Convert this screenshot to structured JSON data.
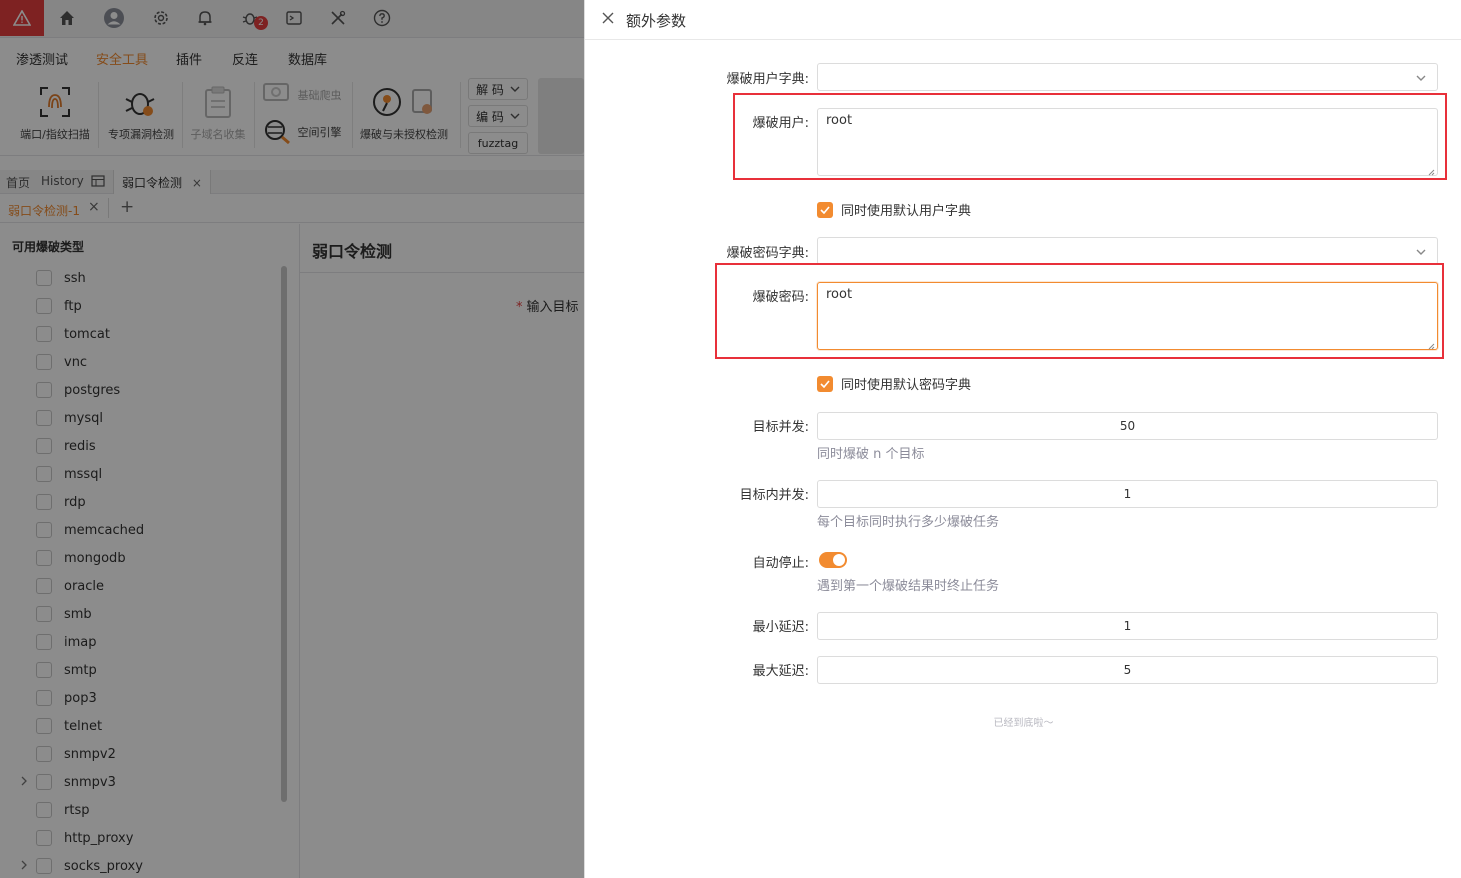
{
  "topbar": {
    "notification_count": "2",
    "icons": [
      "warning-logo-icon",
      "home-icon",
      "user-avatar-icon",
      "settings-gear-icon",
      "bell-icon",
      "bug-icon",
      "terminal-icon",
      "tools-icon",
      "help-icon"
    ]
  },
  "menubar": {
    "items": [
      "渗透测试",
      "安全工具",
      "插件",
      "反连",
      "数据库"
    ],
    "active_index": 1
  },
  "ribbon": {
    "tools": [
      {
        "label": "端口/指纹扫描",
        "icon": "fingerprint-scan-icon",
        "disabled": false
      },
      {
        "label": "专项漏洞检测",
        "icon": "bug-detect-icon",
        "disabled": false
      },
      {
        "label": "子域名收集",
        "icon": "clipboard-icon",
        "disabled": true
      },
      {
        "label": "基础爬虫",
        "icon": "crawler-icon",
        "disabled": true
      },
      {
        "label": "空间引擎",
        "icon": "space-engine-icon",
        "disabled": false
      },
      {
        "label": "爆破与未授权检测",
        "icon": "brute-force-icon",
        "disabled": false
      }
    ],
    "decode_label": "解 码",
    "encode_label": "编 码",
    "fuzztag_label": "fuzztag"
  },
  "tabs_level1": {
    "items": [
      "首页",
      "History",
      "弱口令检测"
    ],
    "close_glyph": "×"
  },
  "tabs_level2": {
    "active": "弱口令检测-1",
    "close_glyph": "×",
    "add_glyph": "+"
  },
  "left_panel": {
    "title": "可用爆破类型",
    "protocols": [
      {
        "name": "ssh",
        "expandable": false
      },
      {
        "name": "ftp",
        "expandable": false
      },
      {
        "name": "tomcat",
        "expandable": false
      },
      {
        "name": "vnc",
        "expandable": false
      },
      {
        "name": "postgres",
        "expandable": false
      },
      {
        "name": "mysql",
        "expandable": false
      },
      {
        "name": "redis",
        "expandable": false
      },
      {
        "name": "mssql",
        "expandable": false
      },
      {
        "name": "rdp",
        "expandable": false
      },
      {
        "name": "memcached",
        "expandable": false
      },
      {
        "name": "mongodb",
        "expandable": false
      },
      {
        "name": "oracle",
        "expandable": false
      },
      {
        "name": "smb",
        "expandable": false
      },
      {
        "name": "imap",
        "expandable": false
      },
      {
        "name": "smtp",
        "expandable": false
      },
      {
        "name": "pop3",
        "expandable": false
      },
      {
        "name": "telnet",
        "expandable": false
      },
      {
        "name": "snmpv2",
        "expandable": false
      },
      {
        "name": "snmpv3",
        "expandable": true
      },
      {
        "name": "rtsp",
        "expandable": false
      },
      {
        "name": "http_proxy",
        "expandable": false
      },
      {
        "name": "socks_proxy",
        "expandable": true
      }
    ]
  },
  "main": {
    "title": "弱口令检测",
    "target_label": "输入目标",
    "required_mark": "*"
  },
  "drawer": {
    "title": "额外参数",
    "user_dict_label": "爆破用户字典:",
    "user_dict_value": "",
    "users_label": "爆破用户:",
    "users_value": "root",
    "use_default_user_dict_label": "同时使用默认用户字典",
    "use_default_user_dict_checked": true,
    "pass_dict_label": "爆破密码字典:",
    "pass_dict_value": "",
    "passwords_label": "爆破密码:",
    "passwords_value": "root",
    "use_default_pass_dict_label": "同时使用默认密码字典",
    "use_default_pass_dict_checked": true,
    "target_concurrency_label": "目标并发:",
    "target_concurrency_value": "50",
    "target_concurrency_help": "同时爆破 n 个目标",
    "inner_concurrency_label": "目标内并发:",
    "inner_concurrency_value": "1",
    "inner_concurrency_help": "每个目标同时执行多少爆破任务",
    "auto_stop_label": "自动停止:",
    "auto_stop_enabled": true,
    "auto_stop_help": "遇到第一个爆破结果时终止任务",
    "min_delay_label": "最小延迟:",
    "min_delay_value": "1",
    "max_delay_label": "最大延迟:",
    "max_delay_value": "5",
    "footer_note": "已经到底啦～"
  },
  "colors": {
    "accent": "#f28b30",
    "highlight_box": "#e8303a",
    "logo_red": "#e53e3e"
  }
}
